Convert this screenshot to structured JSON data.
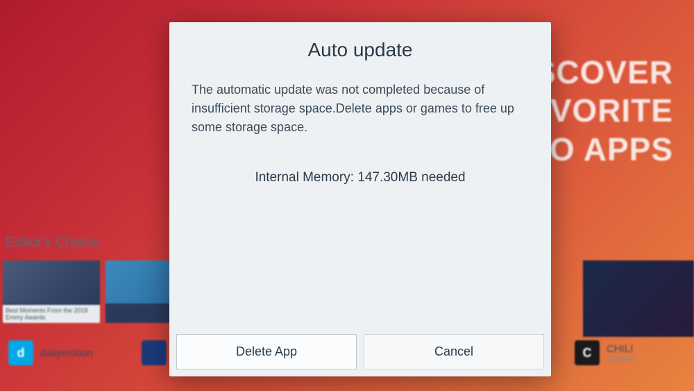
{
  "background": {
    "hero_text_line1": "DISCOVER",
    "hero_text_line2": "YOUR FAVORITE",
    "hero_text_line3": "VIDEO APPS",
    "section_title": "Editor's Choice",
    "tile_caption": "Best Moments From the 2018 Emmy Awards",
    "apps": {
      "dailymotion": {
        "name": "dailymotion",
        "icon_letter": "d"
      },
      "chili": {
        "name": "CHILI",
        "status": "Installed",
        "icon_letter": "C"
      }
    }
  },
  "modal": {
    "title": "Auto update",
    "message": "The automatic update was not completed because of insufficient storage space.Delete apps or games to free up some storage space.",
    "memory_label": "Internal Memory:",
    "memory_value": "147.30MB needed",
    "buttons": {
      "primary": "Delete App",
      "secondary": "Cancel"
    }
  }
}
